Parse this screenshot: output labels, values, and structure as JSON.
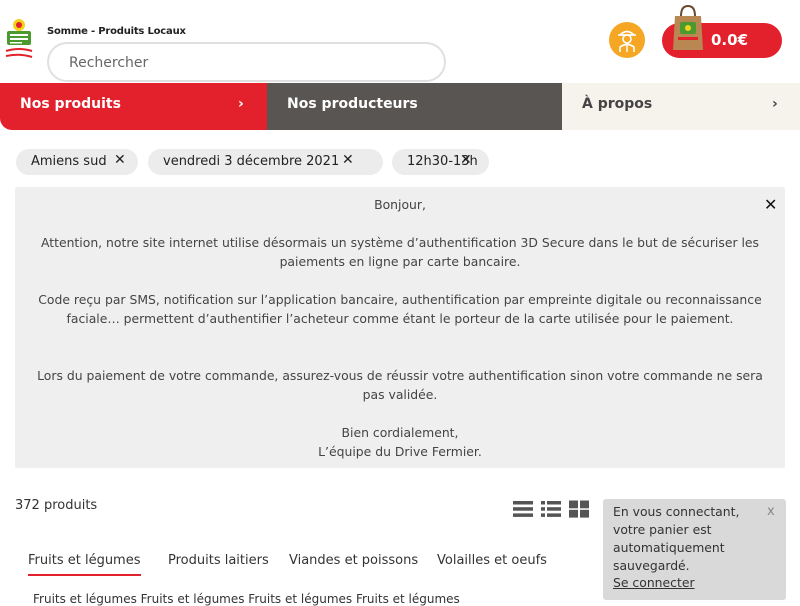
{
  "header": {
    "store_title": "Somme - Produits Locaux",
    "search_placeholder": "Rechercher",
    "cart_amount": "0.0€"
  },
  "nav": {
    "items": [
      {
        "label": "Nos produits",
        "chevron": "›"
      },
      {
        "label": "Nos producteurs"
      },
      {
        "label": "À propos",
        "chevron": "›"
      }
    ]
  },
  "filters": [
    {
      "label": "Amiens sud",
      "remove": "✕"
    },
    {
      "label": "vendredi 3 décembre 2021",
      "remove": "✕"
    },
    {
      "label": "12h30-13h",
      "remove": "✕"
    }
  ],
  "notice": {
    "close": "✕",
    "greeting": "Bonjour,",
    "p1": "Attention, notre site internet utilise désormais un système d’authentification 3D Secure dans le but de sécuriser les paiements en ligne par carte bancaire.",
    "p2": "Code reçu par SMS, notification sur l’application bancaire, authentification par empreinte digitale ou reconnaissance faciale… permettent d’authentifier l’acheteur comme étant le porteur de la carte utilisée pour le paiement.",
    "p3": "Lors du paiement de votre commande, assurez-vous de réussir votre authentification sinon votre commande ne sera pas validée.",
    "sign1": "Bien cordialement,",
    "sign2": "L’équipe du Drive Fermier."
  },
  "products": {
    "count": "372 produits"
  },
  "categories": {
    "tabs": [
      {
        "label": "Fruits et légumes",
        "active": true
      },
      {
        "label": "Produits laitiers"
      },
      {
        "label": "Viandes et poissons"
      },
      {
        "label": "Volailles et oeufs"
      }
    ],
    "subcategories_partial": "Fruits et légumes    Fruits et légumes    Fruits et légumes    Fruits et légumes"
  },
  "toast": {
    "text": "En vous connectant, votre panier est automatiquement sauvegardé.",
    "link": "Se connecter",
    "close": "x"
  },
  "colors": {
    "accent_red": "#e3212d",
    "nav_dark": "#595552",
    "nav_light": "#f6f2ec",
    "account_orange": "#f5a623"
  },
  "icons": {
    "logo": "drive-fermier-logo",
    "account": "farmer-avatar-icon",
    "cart": "shopping-bag-icon",
    "view_list": "list-view-icon",
    "view_compact": "compact-list-view-icon",
    "view_grid": "grid-view-icon"
  }
}
